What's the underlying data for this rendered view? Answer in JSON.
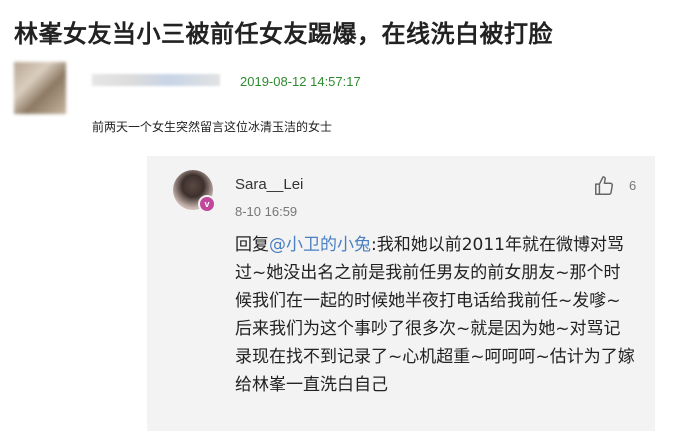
{
  "headline": "林峯女友当小三被前任女友踢爆，在线洗白被打脸",
  "post": {
    "timestamp": "2019-08-12 14:57:17",
    "text": "前两天一个女生突然留言这位冰清玉洁的女士"
  },
  "reply": {
    "username": "Sara__Lei",
    "time": "8-10 16:59",
    "like_count": "6",
    "reply_prefix": "回复",
    "mention": "@小卫的小兔",
    "body": ":我和她以前2011年就在微博对骂过~她没出名之前是我前任男友的前女朋友~那个时候我们在一起的时候她半夜打电话给我前任~发嗲~后来我们为这个事吵了很多次~就是因为她~对骂记录现在找不到记录了~心机超重~呵呵呵~估计为了嫁给林峯一直洗白自己",
    "verified_badge": "v"
  },
  "icons": {
    "like": "thumbs-up-icon",
    "verified": "verified-badge-icon"
  },
  "colors": {
    "timestamp_green": "#2e8b2e",
    "mention_blue": "#4a7fc1",
    "card_bg": "#f3f3f3",
    "badge_pink": "#c0479a"
  }
}
